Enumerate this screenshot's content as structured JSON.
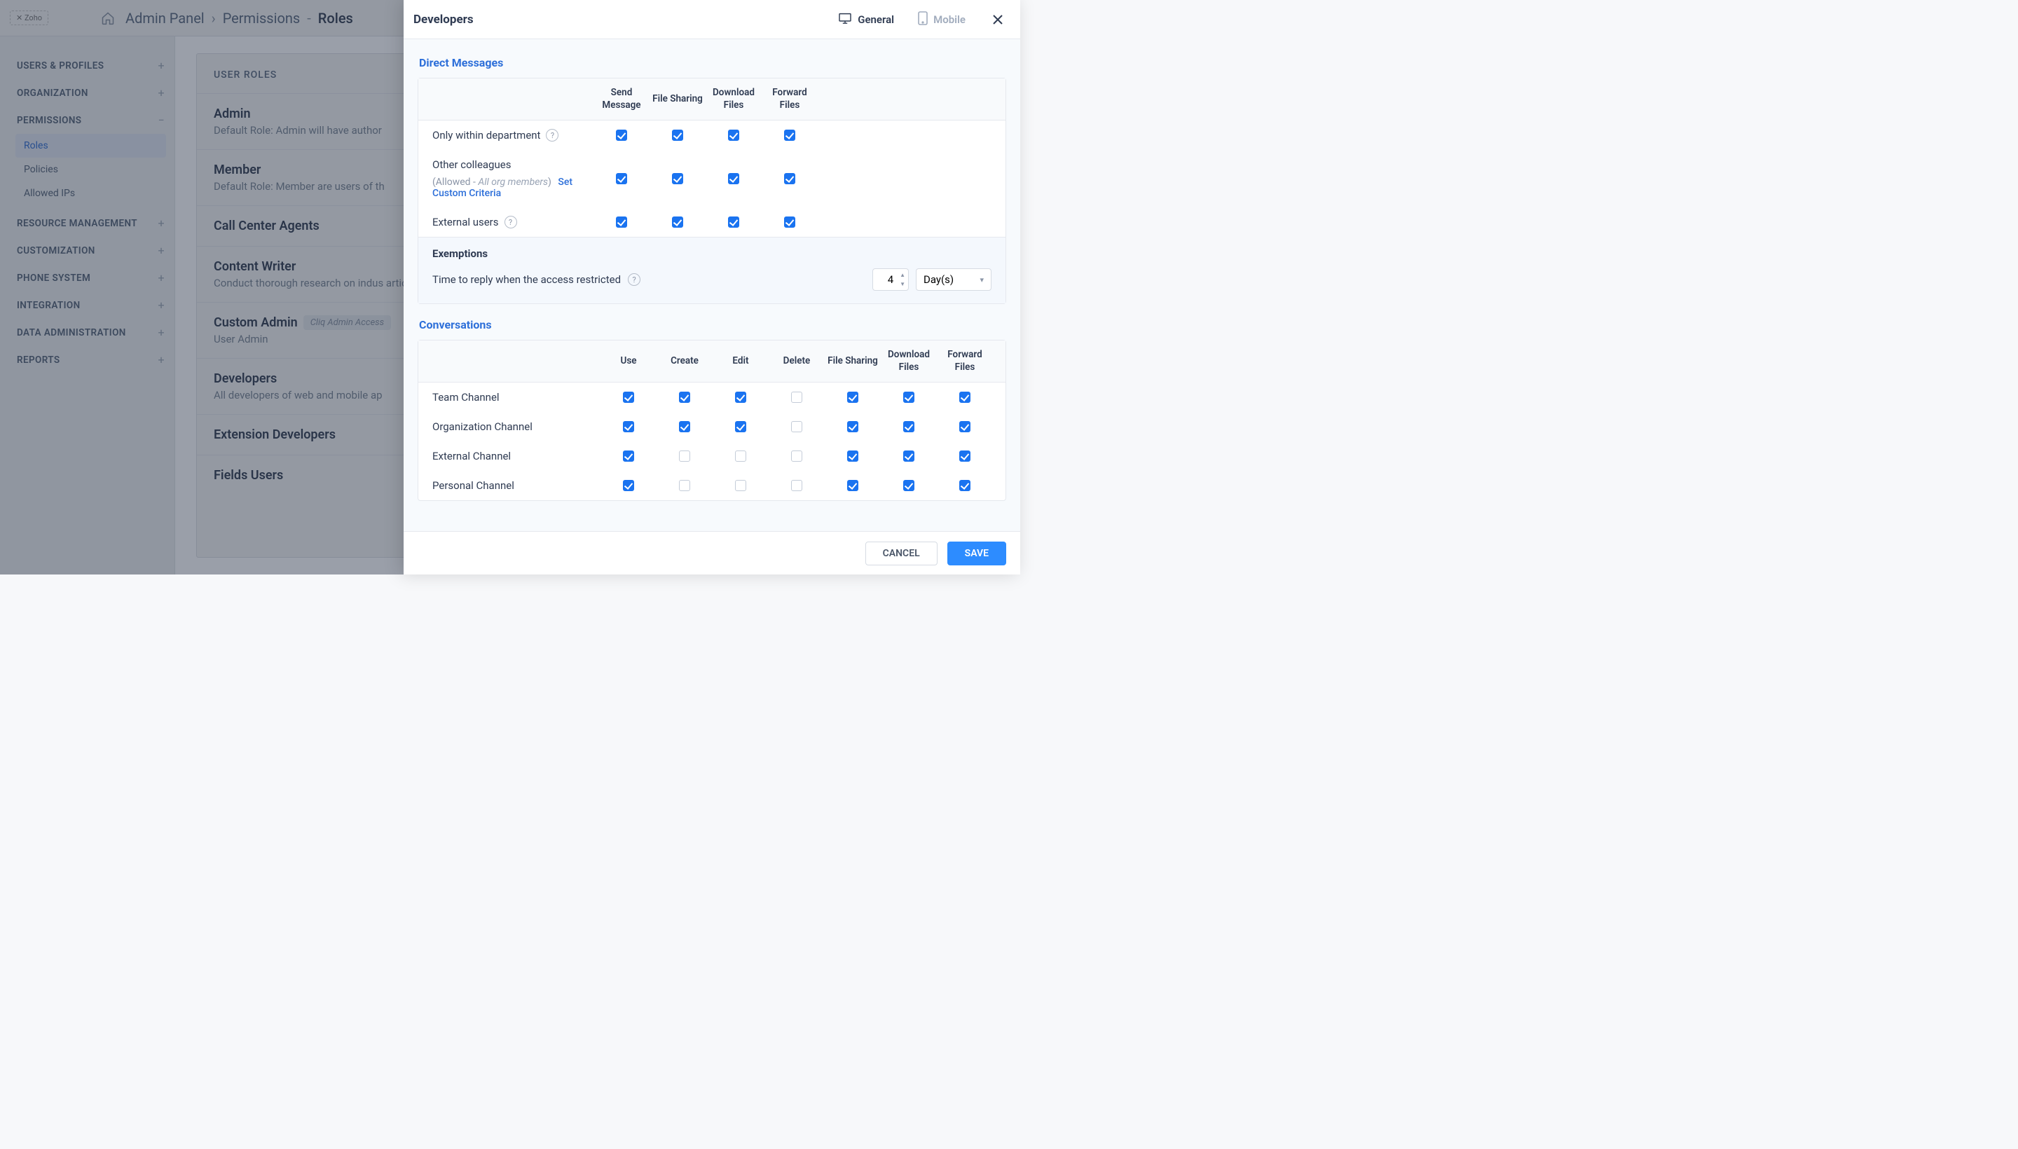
{
  "topbar": {
    "brand": "✕ Zoho",
    "crumb1": "Admin Panel",
    "crumb2": "Permissions",
    "crumb3": "Roles"
  },
  "sidebar": {
    "sections": [
      {
        "label": "USERS & PROFILES",
        "expanded": false
      },
      {
        "label": "ORGANIZATION",
        "expanded": false
      },
      {
        "label": "PERMISSIONS",
        "expanded": true,
        "items": [
          {
            "label": "Roles",
            "active": true
          },
          {
            "label": "Policies"
          },
          {
            "label": "Allowed IPs"
          }
        ]
      },
      {
        "label": "RESOURCE MANAGEMENT",
        "expanded": false
      },
      {
        "label": "CUSTOMIZATION",
        "expanded": false
      },
      {
        "label": "PHONE SYSTEM",
        "expanded": false
      },
      {
        "label": "INTEGRATION",
        "expanded": false
      },
      {
        "label": "DATA ADMINISTRATION",
        "expanded": false
      },
      {
        "label": "REPORTS",
        "expanded": false
      }
    ]
  },
  "main": {
    "title": "USER ROLES",
    "roles": [
      {
        "name": "Admin",
        "desc": "Default Role: Admin will have author"
      },
      {
        "name": "Member",
        "desc": "Default Role: Member are users of th"
      },
      {
        "name": "Call Center Agents",
        "desc": ""
      },
      {
        "name": "Content Writer",
        "desc": "Conduct thorough research on indus articles before publication."
      },
      {
        "name": "Custom Admin",
        "tag": "Cliq Admin Access",
        "desc": "User Admin"
      },
      {
        "name": "Developers",
        "desc": "All developers of web and mobile ap"
      },
      {
        "name": "Extension Developers",
        "desc": ""
      },
      {
        "name": "Fields Users",
        "desc": ""
      }
    ]
  },
  "modal": {
    "title": "Developers",
    "tabs": {
      "general": "General",
      "mobile": "Mobile"
    },
    "directMessages": {
      "title": "Direct Messages",
      "headers": [
        "Send Message",
        "File Sharing",
        "Download Files",
        "Forward Files"
      ],
      "rows": [
        {
          "label": "Only within department",
          "hint": true,
          "checks": [
            true,
            true,
            true,
            true
          ]
        },
        {
          "label": "Other colleagues",
          "sublabel_prefix": "(Allowed - ",
          "sublabel_emph": "All org members",
          "sublabel_suffix": ")",
          "sublabel_link": "Set Custom Criteria",
          "checks": [
            true,
            true,
            true,
            true
          ]
        },
        {
          "label": "External users",
          "hint": true,
          "checks": [
            true,
            true,
            true,
            true
          ]
        }
      ],
      "exemptions": {
        "title": "Exemptions",
        "label": "Time to reply when the access restricted",
        "value": "4",
        "unit": "Day(s)"
      }
    },
    "conversations": {
      "title": "Conversations",
      "headers": [
        "Use",
        "Create",
        "Edit",
        "Delete",
        "File Sharing",
        "Download Files",
        "Forward Files"
      ],
      "rows": [
        {
          "label": "Team Channel",
          "checks": [
            true,
            true,
            true,
            false,
            true,
            true,
            true
          ]
        },
        {
          "label": "Organization Channel",
          "checks": [
            true,
            true,
            true,
            false,
            true,
            true,
            true
          ]
        },
        {
          "label": "External Channel",
          "checks": [
            true,
            false,
            false,
            false,
            true,
            true,
            true
          ]
        },
        {
          "label": "Personal Channel",
          "checks": [
            true,
            false,
            false,
            false,
            true,
            true,
            true
          ]
        }
      ]
    },
    "footer": {
      "cancel": "CANCEL",
      "save": "SAVE"
    }
  }
}
